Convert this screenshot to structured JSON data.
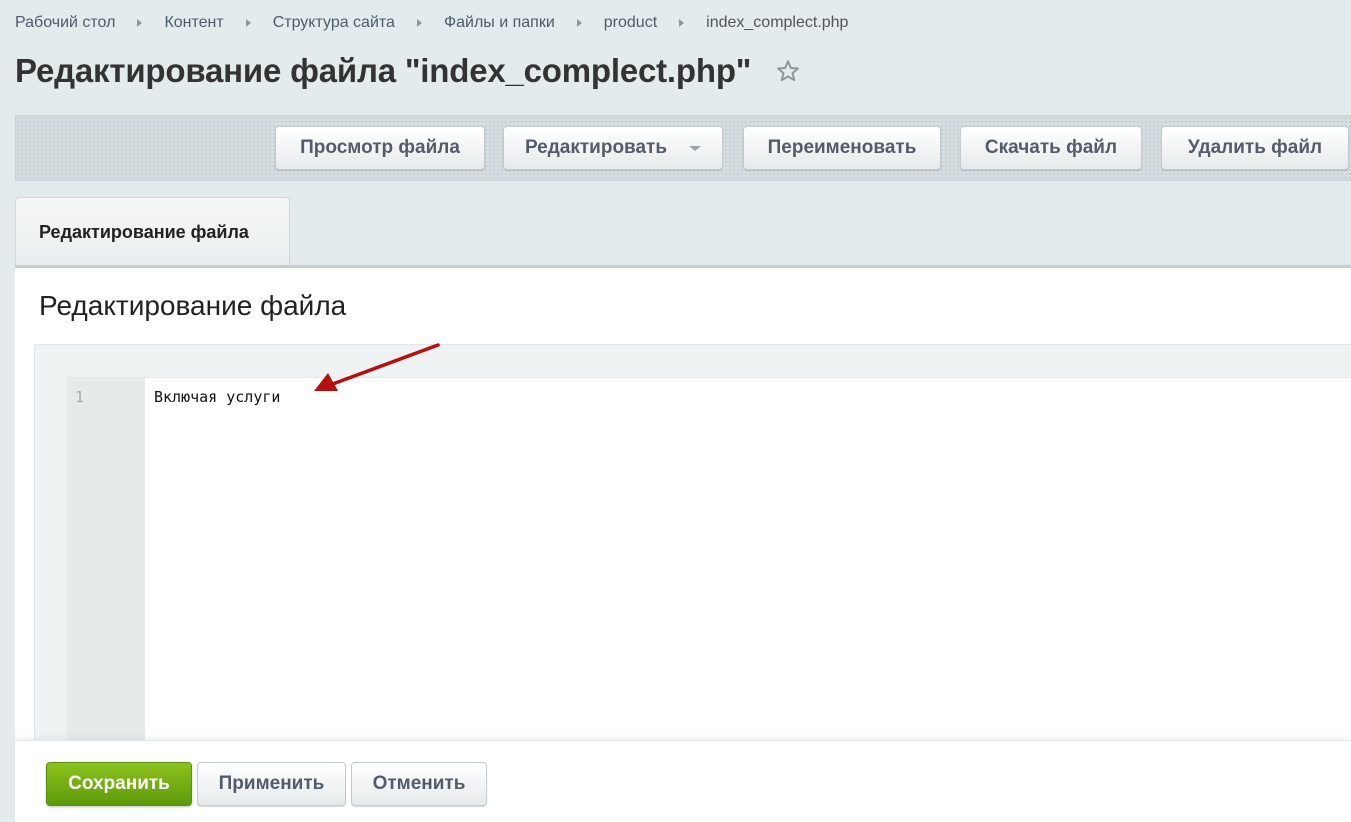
{
  "breadcrumb": {
    "items": [
      "Рабочий стол",
      "Контент",
      "Структура сайта",
      "Файлы и папки",
      "product"
    ],
    "current": "index_complect.php"
  },
  "header": {
    "title": "Редактирование файла \"index_complect.php\"",
    "favorite_icon": "star-outline-icon"
  },
  "toolbar": {
    "view_label": "Просмотр файла",
    "edit_label": "Редактировать",
    "rename_label": "Переименовать",
    "download_label": "Скачать файл",
    "delete_label": "Удалить файл"
  },
  "tabs": [
    {
      "label": "Редактирование файла",
      "active": true
    }
  ],
  "main": {
    "section_title": "Редактирование файла",
    "editor": {
      "line_numbers": [
        "1"
      ],
      "lines": [
        "Включая услуги"
      ]
    },
    "annotation_icon": "red-arrow-icon"
  },
  "footer": {
    "save_label": "Сохранить",
    "apply_label": "Применить",
    "cancel_label": "Отменить"
  },
  "colors": {
    "primary_green": "#7ab51d",
    "annotation_red": "#b50f0f",
    "background": "#e4ebec"
  }
}
